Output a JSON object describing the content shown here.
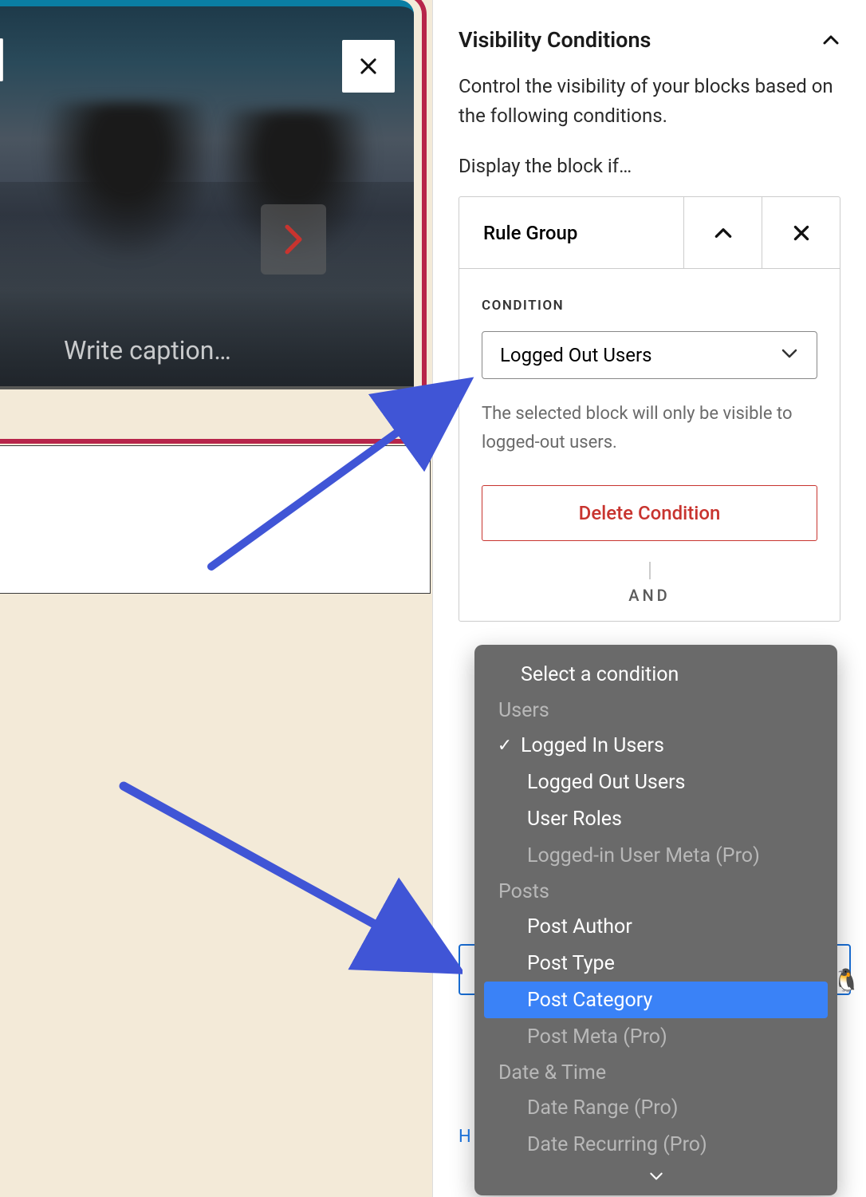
{
  "panel": {
    "title": "Visibility Conditions",
    "description": "Control the visibility of your blocks based on the following conditions.",
    "prompt": "Display the block if…"
  },
  "rule_group": {
    "title": "Rule Group",
    "condition_label": "CONDITION",
    "selected_condition": "Logged Out Users",
    "helper_text": "The selected block will only be visible to logged-out users.",
    "delete_label": "Delete Condition",
    "operator": "AND"
  },
  "dropdown": {
    "placeholder": "Select a condition",
    "groups": [
      {
        "label": "Users",
        "options": [
          {
            "label": "Logged In Users",
            "checked": true,
            "disabled": false
          },
          {
            "label": "Logged Out Users",
            "checked": false,
            "disabled": false
          },
          {
            "label": "User Roles",
            "checked": false,
            "disabled": false
          },
          {
            "label": "Logged-in User Meta (Pro)",
            "checked": false,
            "disabled": true
          }
        ]
      },
      {
        "label": "Posts",
        "options": [
          {
            "label": "Post Author",
            "checked": false,
            "disabled": false
          },
          {
            "label": "Post Type",
            "checked": false,
            "disabled": false
          },
          {
            "label": "Post Category",
            "checked": false,
            "disabled": false,
            "highlighted": true
          },
          {
            "label": "Post Meta (Pro)",
            "checked": false,
            "disabled": true
          }
        ]
      },
      {
        "label": "Date & Time",
        "options": [
          {
            "label": "Date Range (Pro)",
            "checked": false,
            "disabled": true
          },
          {
            "label": "Date Recurring (Pro)",
            "checked": false,
            "disabled": true
          }
        ]
      }
    ]
  },
  "gallery": {
    "caption_placeholder": "Write caption…"
  },
  "footer": {
    "link_prefix": "H"
  }
}
